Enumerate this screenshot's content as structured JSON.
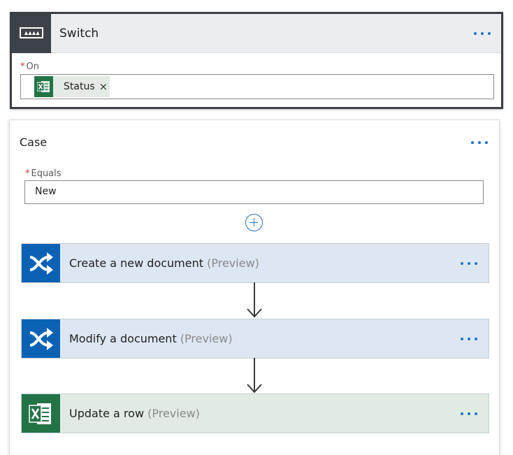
{
  "switch": {
    "title": "Switch",
    "on_label": "On",
    "required_mark": "*",
    "token": {
      "label": "Status",
      "remove_glyph": "×",
      "icon": "excel-icon"
    },
    "icon": "switch-icon"
  },
  "case": {
    "title": "Case",
    "equals_label": "Equals",
    "required_mark": "*",
    "equals_value": "New",
    "add_icon": "add-step-icon"
  },
  "actions": [
    {
      "title": "Create a new document",
      "suffix": "(Preview)",
      "icon": "shuffle-connector-icon",
      "color": "#0b62b5"
    },
    {
      "title": "Modify a document",
      "suffix": "(Preview)",
      "icon": "shuffle-connector-icon",
      "color": "#0b62b5"
    },
    {
      "title": "Update a row",
      "suffix": "(Preview)",
      "icon": "excel-icon",
      "color": "#227447"
    }
  ],
  "colors": {
    "accent": "#1f73c9",
    "switch_header_bg": "#ecedf0",
    "blue_action_bg": "#dce7f3",
    "green_action_bg": "#e1ebe3"
  }
}
